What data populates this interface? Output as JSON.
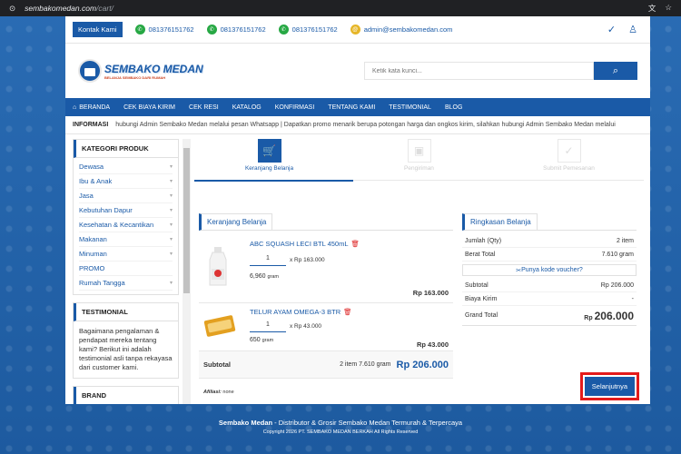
{
  "browser": {
    "url_host": "sembakomedan.com",
    "url_path": "/cart/"
  },
  "topbar": {
    "kontak": "Kontak Kami",
    "phones": [
      "081376151762",
      "081376151762",
      "081376151762"
    ],
    "email": "admin@sembakomedan.com"
  },
  "logo": {
    "name": "SEMBAKO MEDAN",
    "tagline": "BELANJA SEMBAKO DARI RUMAH"
  },
  "search": {
    "placeholder": "Ketik kata kunci..."
  },
  "nav": [
    "BERANDA",
    "CEK BIAYA KIRIM",
    "CEK RESI",
    "KATALOG",
    "KONFIRMASI",
    "TENTANG KAMI",
    "TESTIMONIAL",
    "BLOG"
  ],
  "info": {
    "label": "INFORMASI",
    "text": "hubungi Admin Sembako Medan melalui pesan Whatsapp   |   Dapatkan promo menarik berupa potongan harga dan ongkos kirim, silahkan hubungi Admin Sembako Medan melalui"
  },
  "sidebar": {
    "kategori_title": "KATEGORI PRODUK",
    "kategori": [
      "Dewasa",
      "Ibu & Anak",
      "Jasa",
      "Kebutuhan Dapur",
      "Kesehatan & Kecantikan",
      "Makanan",
      "Minuman",
      "PROMO",
      "Rumah Tangga"
    ],
    "testimonial_title": "TESTIMONIAL",
    "testimonial_text": "Bagaimana pengalaman & pendapat mereka tentang kami? Berikut ini adalah testimonial asli tanpa rekayasa dari customer kami.",
    "brand_title": "BRAND"
  },
  "steps": [
    "Keranjang Belanja",
    "Pengiriman",
    "Submit Pemesanan"
  ],
  "cart": {
    "title": "Keranjang Belanja",
    "items": [
      {
        "name": "ABC SQUASH LECI BTL 450mL",
        "qty": "1",
        "unit_price": "x Rp 163.000",
        "weight": "6,960",
        "weight_unit": "gram",
        "total": "Rp 163.000"
      },
      {
        "name": "TELUR AYAM OMEGA-3 BTR",
        "qty": "1",
        "unit_price": "x Rp 43.000",
        "weight": "650",
        "weight_unit": "gram",
        "total": "Rp 43.000"
      }
    ],
    "subtotal_label": "Subtotal",
    "subtotal_info": "2 item  7.610 gram",
    "subtotal_value": "Rp 206.000",
    "afiliasi_label": "Afiliasi:",
    "afiliasi_value": "none"
  },
  "summary": {
    "title": "Ringkasan Belanja",
    "jumlah_label": "Jumlah (Qty)",
    "jumlah_value": "2 item",
    "berat_label": "Berat Total",
    "berat_value": "7.610 gram",
    "voucher": "Punya kode voucher?",
    "subtotal_label": "Subtotal",
    "subtotal_value": "Rp 206.000",
    "biaya_label": "Biaya Kirim",
    "biaya_value": "-",
    "grand_label": "Grand Total",
    "grand_currency": "Rp",
    "grand_value": "206.000",
    "next_button": "Selanjutnya"
  },
  "footer": {
    "brand": "Sembako Medan",
    "tagline": " - Distributor & Grosir Sembako Medan Termurah & Terpercaya",
    "copyright": "Copyright 2026 PT. SEMBAKO MEDAN BERKAH All Rights Reserved"
  },
  "colors": {
    "primary": "#1a5aa7",
    "highlight": "#e41b1b",
    "whatsapp": "#27a844"
  }
}
